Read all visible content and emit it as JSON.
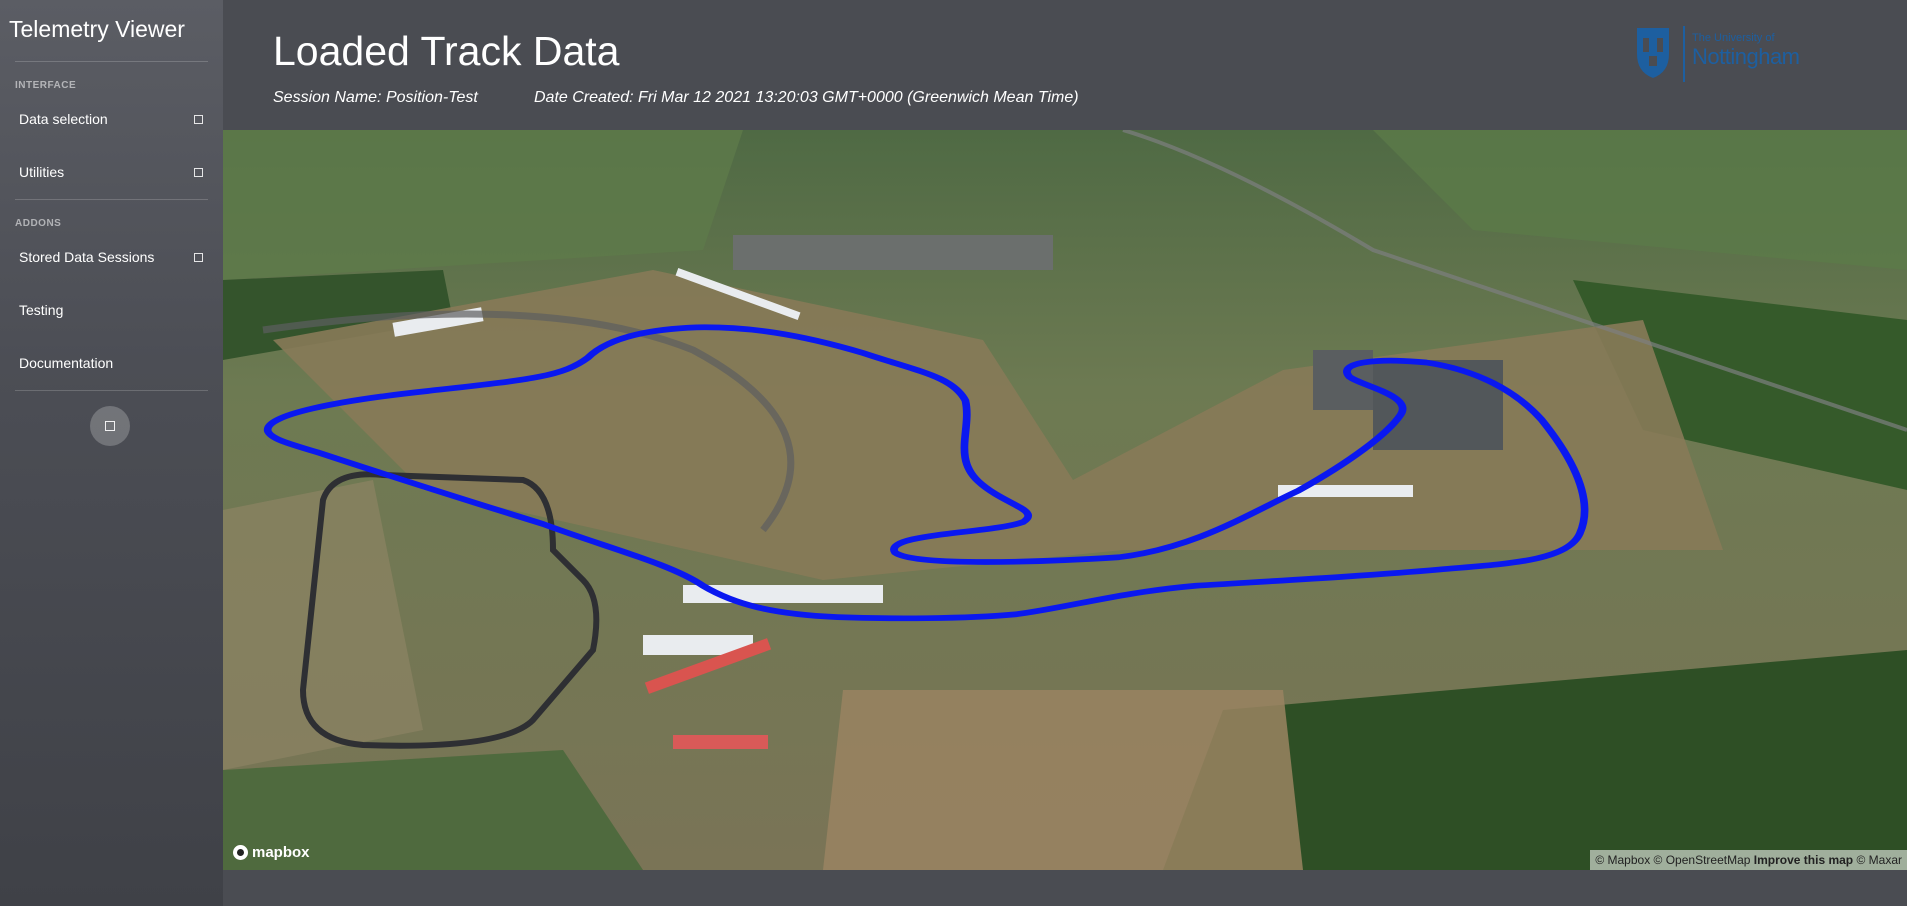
{
  "app": {
    "title": "Telemetry Viewer"
  },
  "sidebar": {
    "sections": [
      {
        "heading": "INTERFACE",
        "items": [
          {
            "label": "Data selection",
            "has_toggle": true
          },
          {
            "label": "Utilities",
            "has_toggle": true
          }
        ]
      },
      {
        "heading": "ADDONS",
        "items": [
          {
            "label": "Stored Data Sessions",
            "has_toggle": true
          },
          {
            "label": "Testing",
            "has_toggle": false
          },
          {
            "label": "Documentation",
            "has_toggle": false
          }
        ]
      }
    ]
  },
  "header": {
    "title": "Loaded Track Data",
    "session_name": "Session Name: Position-Test",
    "date_created": "Date Created: Fri Mar 12 2021 13:20:03 GMT+0000 (Greenwich Mean Time)",
    "logo_line1": "The University of",
    "logo_line2": "Nottingham"
  },
  "map": {
    "logo_text": "mapbox",
    "attribution_mapbox": "© Mapbox",
    "attribution_osm": "© OpenStreetMap",
    "attribution_improve": "Improve this map",
    "attribution_maxar": "© Maxar",
    "track_color": "#0a18f0"
  },
  "colors": {
    "sidebar_bg": "#4c4e55",
    "page_bg": "#4a4c52",
    "logo_blue": "#1d5fa0"
  }
}
